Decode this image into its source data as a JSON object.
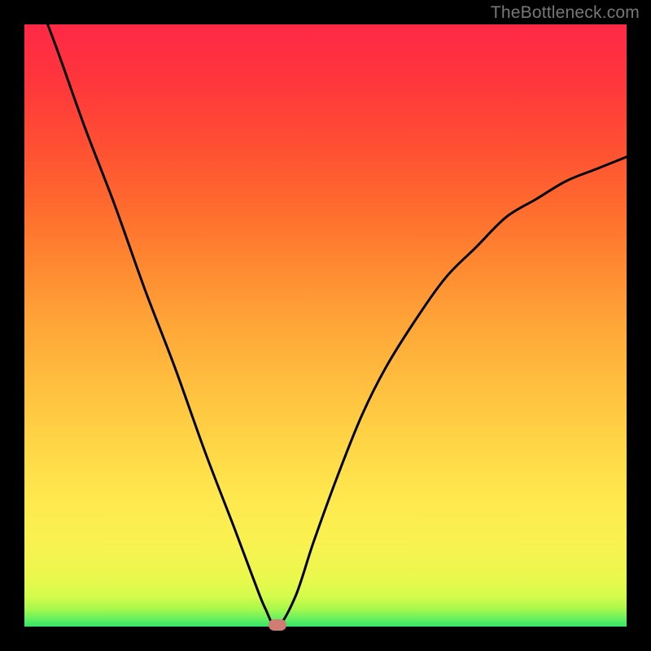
{
  "watermark": {
    "text": "TheBottleneck.com"
  },
  "colors": {
    "background": "#000000",
    "curve_stroke": "#000000",
    "marker_fill": "#d27d73",
    "gradient_top": "#ff2846",
    "gradient_bottom": "#34e569"
  },
  "chart_data": {
    "type": "line",
    "title": "",
    "xlabel": "",
    "ylabel": "",
    "xlim": [
      0,
      100
    ],
    "ylim": [
      0,
      100
    ],
    "grid": false,
    "legend": false,
    "series": [
      {
        "name": "bottleneck-curve",
        "x": [
          0,
          5,
          10,
          15,
          20,
          25,
          30,
          35,
          38,
          40,
          42,
          45,
          48,
          52,
          56,
          60,
          65,
          70,
          75,
          80,
          85,
          90,
          95,
          100
        ],
        "values": [
          110,
          97,
          83,
          70,
          56,
          43,
          29,
          16,
          8,
          3,
          0,
          5,
          14,
          25,
          35,
          43,
          51,
          58,
          63,
          68,
          71,
          74,
          76,
          78
        ]
      }
    ],
    "annotations": [
      {
        "name": "optimal-marker",
        "x": 42,
        "y": 0
      }
    ]
  }
}
